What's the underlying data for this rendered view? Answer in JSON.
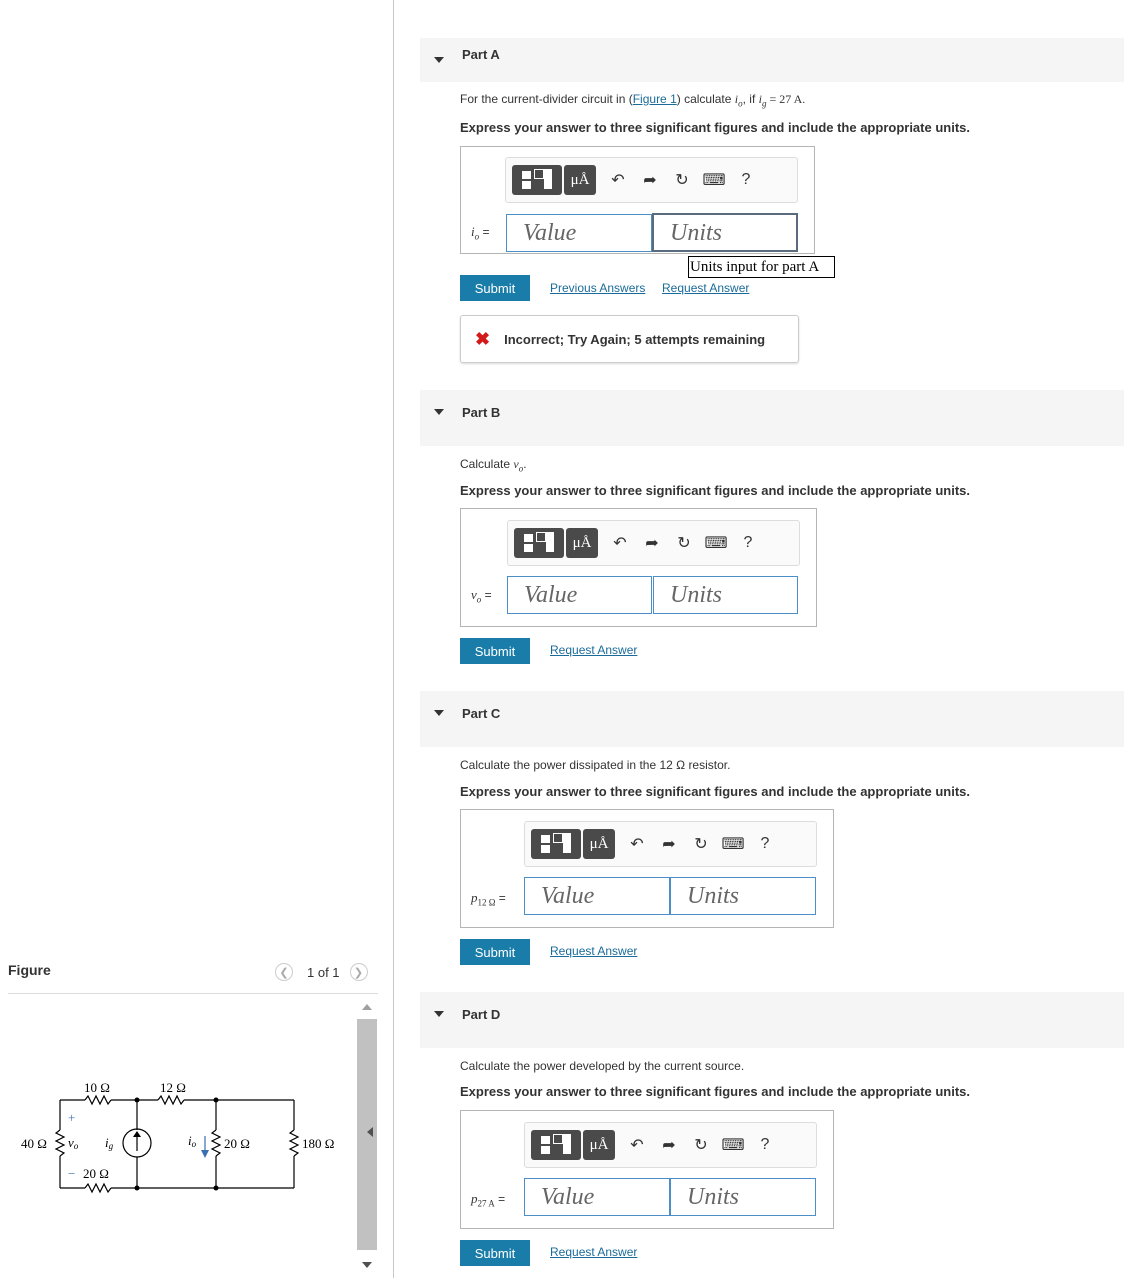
{
  "figure": {
    "title": "Figure",
    "pager_text": "1 of 1",
    "prev_icon": "chevron-left-icon",
    "next_icon": "chevron-right-icon",
    "circuit": {
      "r10": "10 Ω",
      "r12": "12 Ω",
      "r40": "40 Ω",
      "r20_bottom": "20 Ω",
      "r20_right": "20 Ω",
      "r180": "180 Ω",
      "vo": "v",
      "vo_sub": "o",
      "ig": "i",
      "ig_sub": "g",
      "io": "i",
      "io_sub": "o",
      "plus": "+",
      "minus": "−"
    }
  },
  "tooltip": "Units input for part A",
  "parts": [
    {
      "title": "Part A",
      "question_pre": "For the current-divider circuit in (",
      "figure_link": "Figure 1",
      "question_mid": ") calculate ",
      "question_var": "i",
      "question_var_sub": "o",
      "question_mid2": ", if ",
      "question_var2": "i",
      "question_var2_sub": "g",
      "question_post": " = 27 A.",
      "instructions": "Express your answer to three significant figures and include the appropriate units.",
      "label": "i",
      "label_sub": "o",
      "label_eq": " =",
      "value_placeholder": "Value",
      "units_placeholder": "Units",
      "submit": "Submit",
      "previous": "Previous Answers",
      "request": "Request Answer",
      "feedback": "Incorrect; Try Again; 5 attempts remaining"
    },
    {
      "title": "Part B",
      "question": "Calculate ",
      "question_var": "v",
      "question_var_sub": "o",
      "question_post": ".",
      "instructions": "Express your answer to three significant figures and include the appropriate units.",
      "label": "v",
      "label_sub": "o",
      "label_eq": " =",
      "value_placeholder": "Value",
      "units_placeholder": "Units",
      "submit": "Submit",
      "request": "Request Answer"
    },
    {
      "title": "Part C",
      "question": "Calculate the power dissipated in the 12 Ω resistor.",
      "instructions": "Express your answer to three significant figures and include the appropriate units.",
      "label": "p",
      "label_sub": "12 Ω",
      "label_eq": " =",
      "value_placeholder": "Value",
      "units_placeholder": "Units",
      "submit": "Submit",
      "request": "Request Answer"
    },
    {
      "title": "Part D",
      "question": "Calculate the power developed by the current source.",
      "instructions": "Express your answer to three significant figures and include the appropriate units.",
      "label": "p",
      "label_sub": "27 A",
      "label_eq": " =",
      "value_placeholder": "Value",
      "units_placeholder": "Units",
      "submit": "Submit",
      "request": "Request Answer"
    }
  ],
  "toolbar": {
    "units_button": "μÅ",
    "help": "?",
    "icons": [
      "templates-icon",
      "units-icon",
      "undo-icon",
      "redo-icon",
      "reset-icon",
      "keyboard-icon",
      "help-icon"
    ]
  },
  "colors": {
    "submit_bg": "#1a7ca8",
    "link": "#1a6b9a",
    "incorrect": "#d21a1a",
    "header_bg": "#f5f5f5"
  }
}
